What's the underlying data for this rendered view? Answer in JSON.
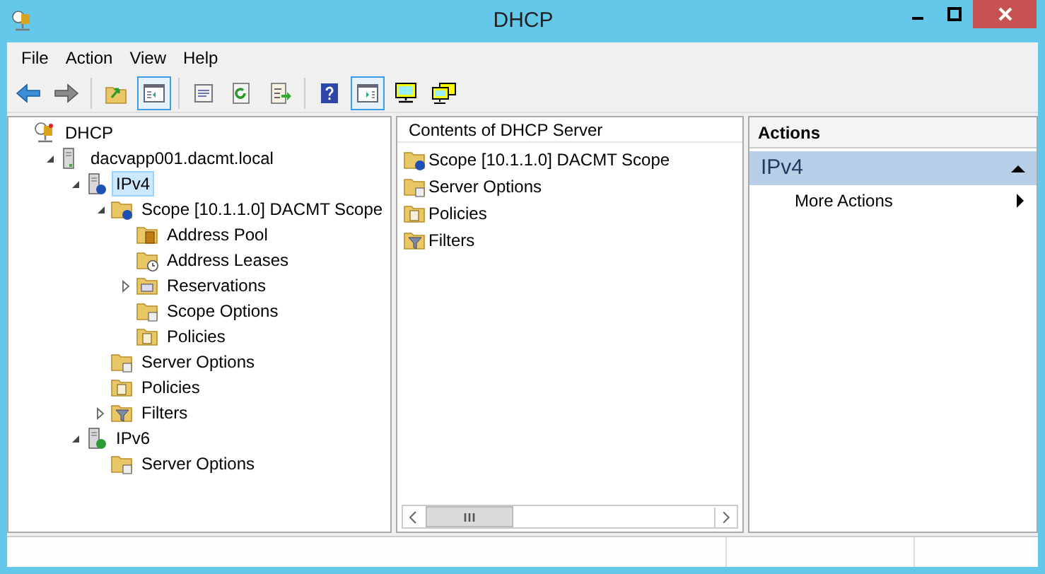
{
  "window": {
    "title": "DHCP"
  },
  "menu": [
    {
      "label": "File"
    },
    {
      "label": "Action"
    },
    {
      "label": "View"
    },
    {
      "label": "Help"
    }
  ],
  "toolbar": [
    {
      "kind": "back",
      "pressed": false
    },
    {
      "kind": "forward",
      "pressed": false
    },
    {
      "kind": "sep"
    },
    {
      "kind": "up",
      "pressed": false
    },
    {
      "kind": "tree",
      "pressed": true
    },
    {
      "kind": "sep"
    },
    {
      "kind": "properties",
      "pressed": false
    },
    {
      "kind": "refresh",
      "pressed": false
    },
    {
      "kind": "export",
      "pressed": false
    },
    {
      "kind": "sep"
    },
    {
      "kind": "help",
      "pressed": false
    },
    {
      "kind": "pane",
      "pressed": true
    },
    {
      "kind": "monitor",
      "pressed": false
    },
    {
      "kind": "monitors",
      "pressed": false
    }
  ],
  "tree": [
    {
      "label": "DHCP",
      "kind": "dhcp",
      "selected": false,
      "children": [
        {
          "label": "dacvapp001.dacmt.local",
          "kind": "server",
          "expanded": true,
          "selected": false,
          "children": [
            {
              "label": "IPv4",
              "kind": "ipv4",
              "expanded": true,
              "selected": true,
              "children": [
                {
                  "label": "Scope [10.1.1.0] DACMT Scope",
                  "kind": "scope",
                  "expanded": true,
                  "selected": false,
                  "children": [
                    {
                      "label": "Address Pool",
                      "kind": "pool",
                      "selected": false
                    },
                    {
                      "label": "Address Leases",
                      "kind": "leases",
                      "selected": false
                    },
                    {
                      "label": "Reservations",
                      "kind": "reservations",
                      "expanded": false,
                      "selected": false
                    },
                    {
                      "label": "Scope Options",
                      "kind": "options",
                      "selected": false
                    },
                    {
                      "label": "Policies",
                      "kind": "policies",
                      "selected": false
                    }
                  ]
                },
                {
                  "label": "Server Options",
                  "kind": "options",
                  "selected": false
                },
                {
                  "label": "Policies",
                  "kind": "policies",
                  "selected": false
                },
                {
                  "label": "Filters",
                  "kind": "filters",
                  "expanded": false,
                  "selected": false
                }
              ]
            },
            {
              "label": "IPv6",
              "kind": "ipv6",
              "expanded": true,
              "selected": false,
              "children": [
                {
                  "label": "Server Options",
                  "kind": "options",
                  "selected": false
                }
              ]
            }
          ]
        }
      ]
    }
  ],
  "contents": {
    "header": "Contents of DHCP Server",
    "items": [
      {
        "label": "Scope [10.1.1.0] DACMT Scope",
        "kind": "scope"
      },
      {
        "label": "Server Options",
        "kind": "options"
      },
      {
        "label": "Policies",
        "kind": "policies"
      },
      {
        "label": "Filters",
        "kind": "filters"
      }
    ]
  },
  "actions": {
    "header": "Actions",
    "section": {
      "label": "IPv4",
      "expanded": true
    },
    "items": [
      {
        "label": "More Actions"
      }
    ]
  }
}
